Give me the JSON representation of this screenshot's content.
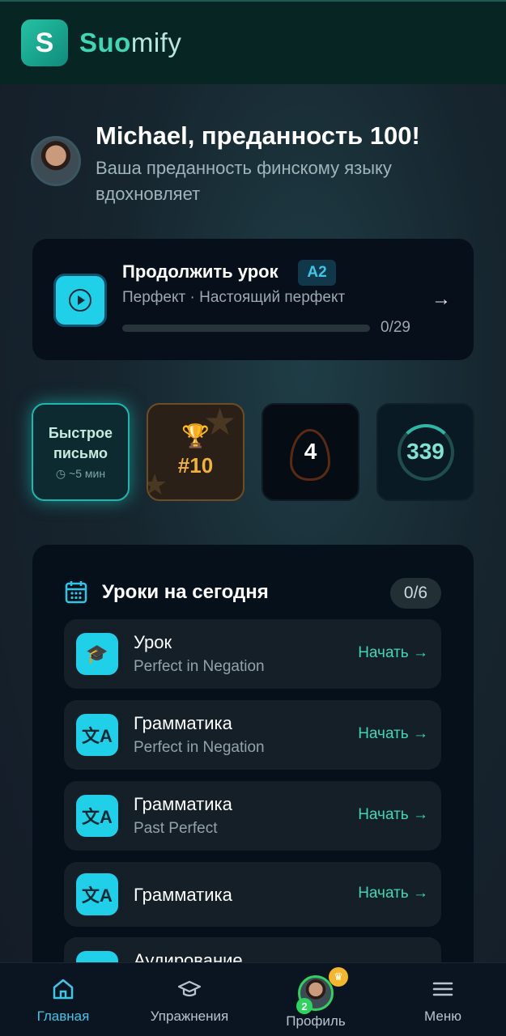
{
  "app": {
    "logo_letter": "S",
    "brand_part1": "Suo",
    "brand_part2": "mify",
    "accent_color": "#3fd6b6"
  },
  "greeting": {
    "title": "Michael, преданность 100!",
    "subtitle": "Ваша преданность финскому языку вдохновляет"
  },
  "continue_lesson": {
    "title": "Продолжить урок",
    "level": "A2",
    "subtitle": "Перфект · Настоящий перфект",
    "progress_label": "0/29",
    "progress_fraction": 0
  },
  "tiles": {
    "quick": {
      "title": "Быстрое письмо",
      "time": "◷ ~5 мин"
    },
    "rank": {
      "value": "#10",
      "icon": "trophy-icon"
    },
    "streak": {
      "value": "4",
      "icon": "flame-icon"
    },
    "score": {
      "value": "339"
    }
  },
  "today": {
    "title": "Уроки на сегодня",
    "count": "0/6",
    "items": [
      {
        "title": "Урок",
        "subtitle": "Perfect in Negation",
        "action": "Начать →",
        "icon": "graduation-cap-icon"
      },
      {
        "title": "Грамматика",
        "subtitle": "Perfect in Negation",
        "action": "Начать →",
        "icon": "translate-icon"
      },
      {
        "title": "Грамматика",
        "subtitle": "Past Perfect",
        "action": "Начать →",
        "icon": "translate-icon"
      },
      {
        "title": "Грамматика",
        "subtitle": "",
        "action": "Начать →",
        "icon": "translate-icon"
      },
      {
        "title": "Аудирование",
        "subtitle": "",
        "action": "",
        "icon": "headphones-icon"
      }
    ]
  },
  "nav": {
    "home": "Главная",
    "exercises": "Упражнения",
    "profile": "Профиль",
    "profile_badge": "2",
    "menu": "Меню"
  }
}
